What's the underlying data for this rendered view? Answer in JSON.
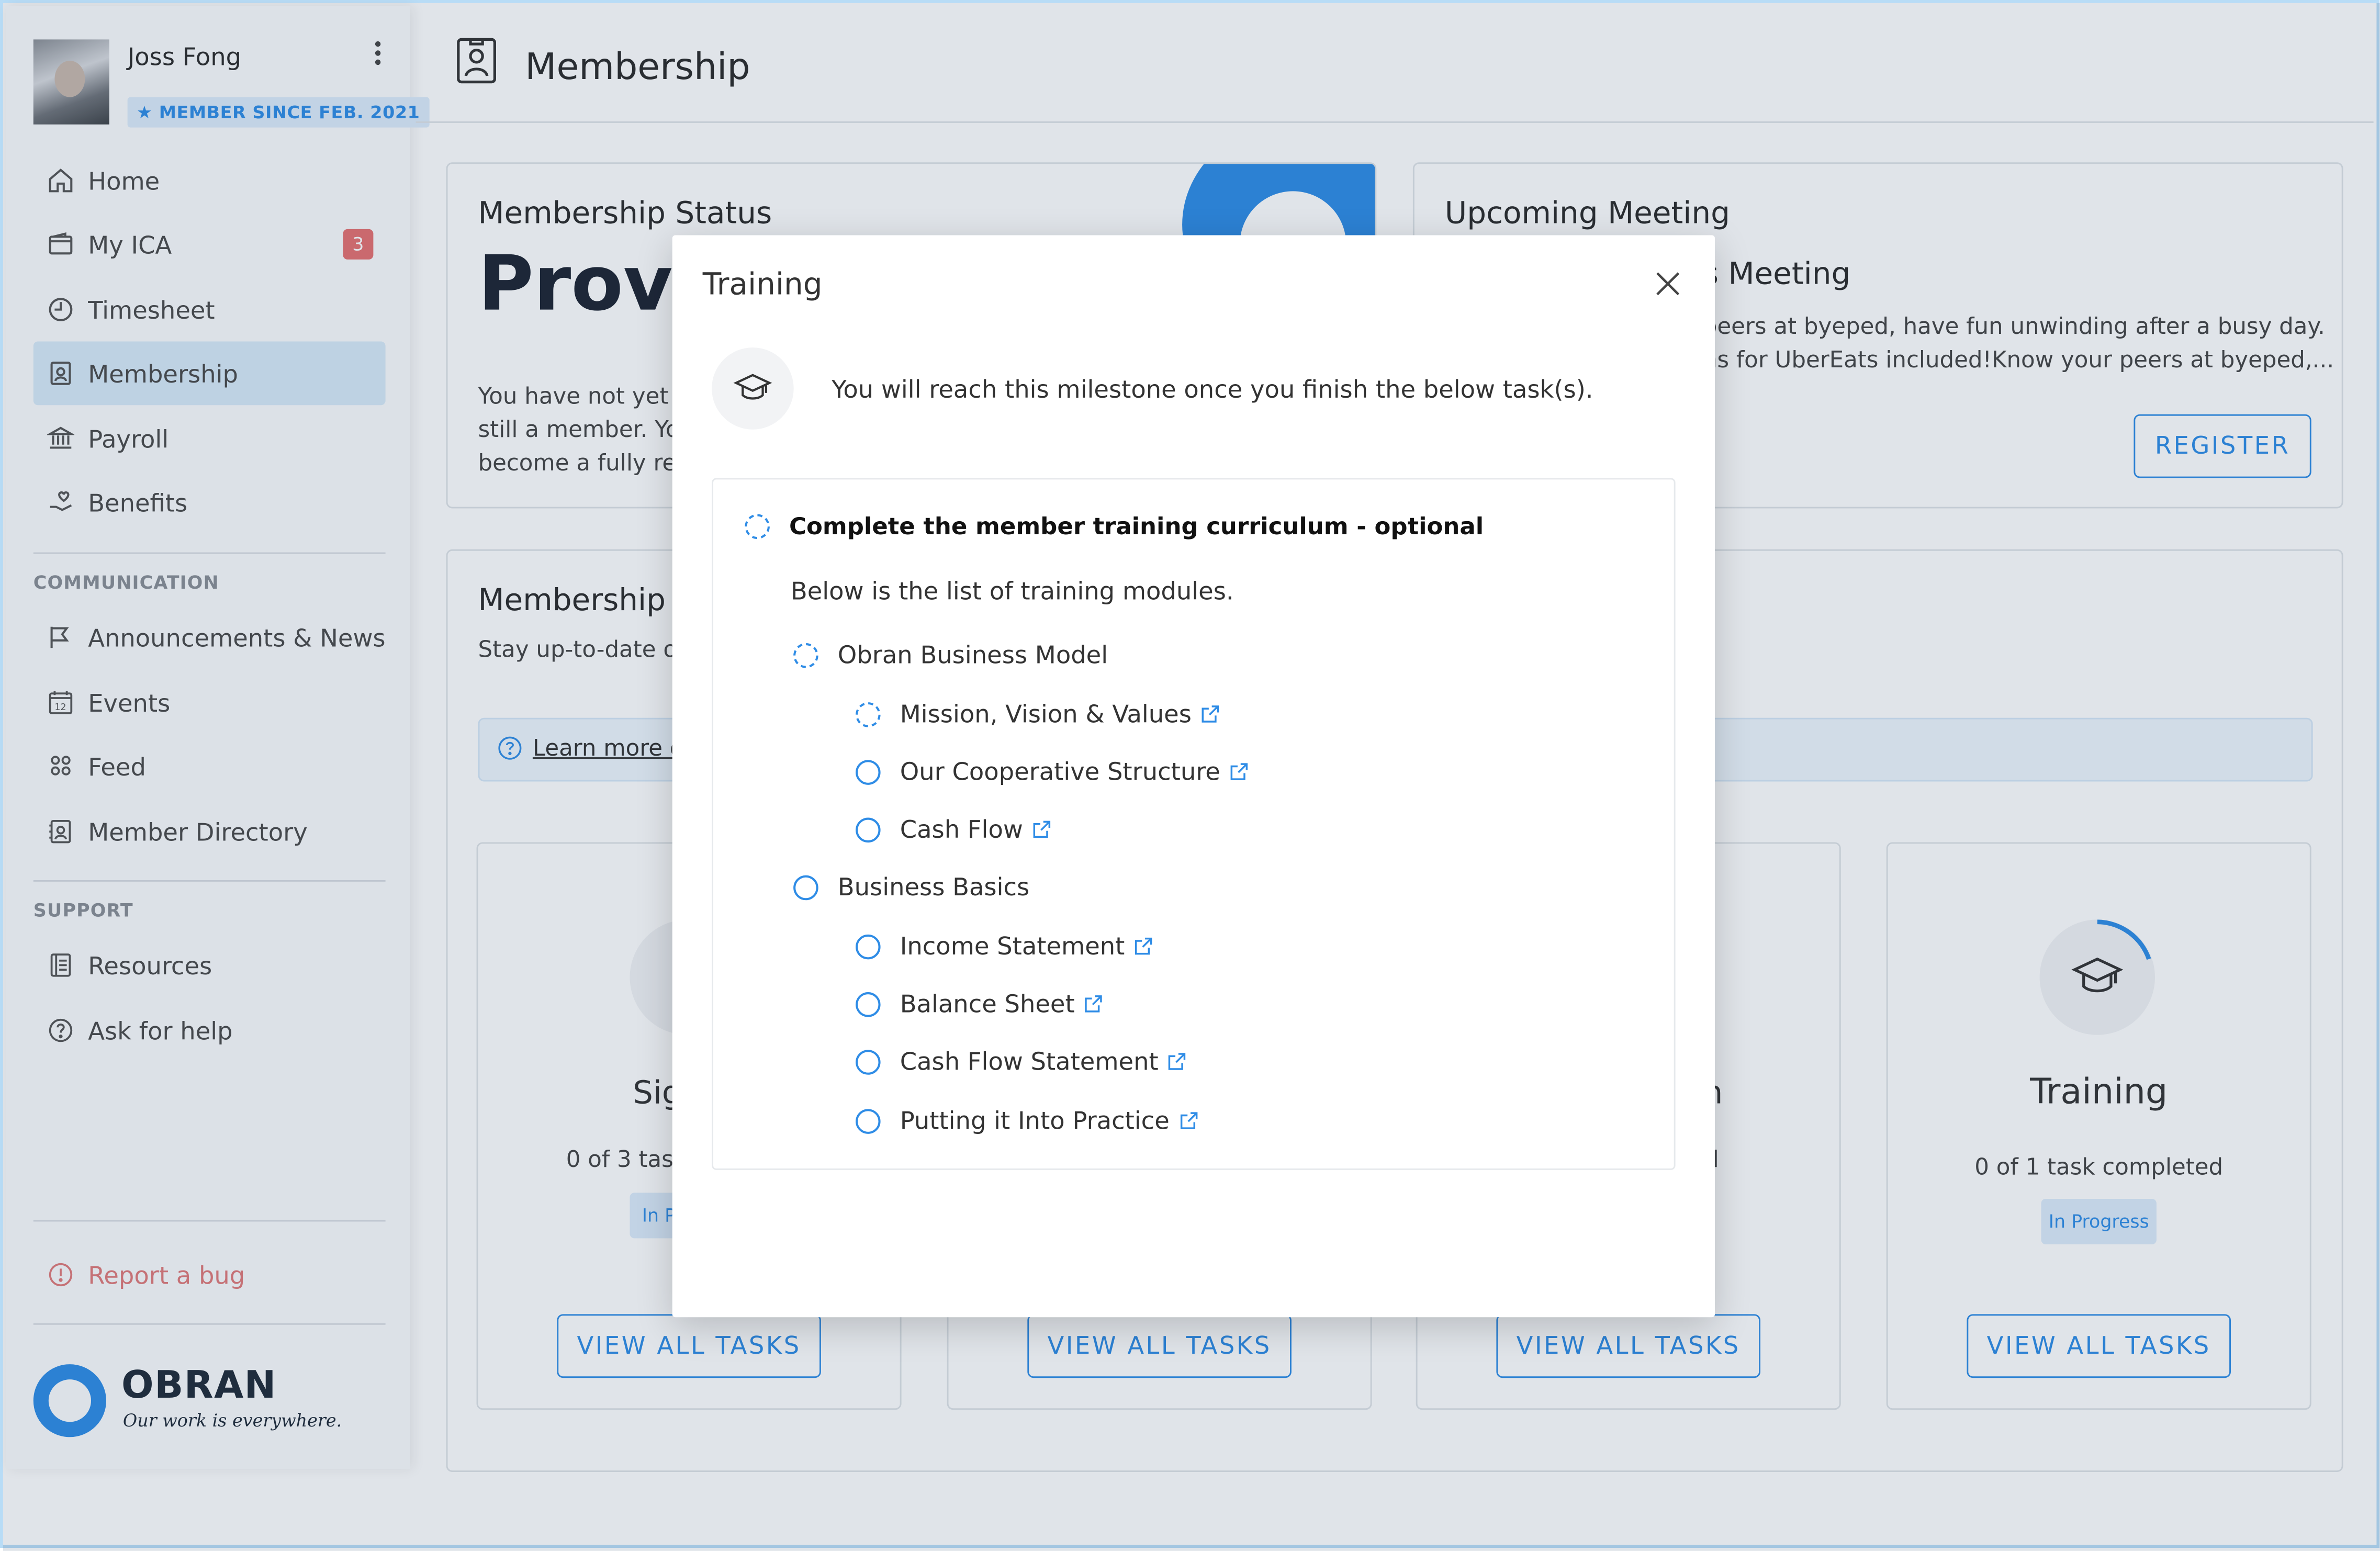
{
  "profile": {
    "name": "Joss Fong",
    "member_since": "MEMBER SINCE FEB. 2021"
  },
  "sidebar": {
    "items": [
      {
        "label": "Home",
        "icon": "home-icon"
      },
      {
        "label": "My ICA",
        "icon": "wallet-icon",
        "badge": "3"
      },
      {
        "label": "Timesheet",
        "icon": "clock-icon"
      },
      {
        "label": "Membership",
        "icon": "badge-icon",
        "active": true
      },
      {
        "label": "Payroll",
        "icon": "bank-icon"
      },
      {
        "label": "Benefits",
        "icon": "hand-heart-icon"
      }
    ],
    "communication_label": "COMMUNICATION",
    "communication": [
      {
        "label": "Announcements & News",
        "icon": "flag-icon"
      },
      {
        "label": "Events",
        "icon": "calendar-icon"
      },
      {
        "label": "Feed",
        "icon": "people-icon"
      },
      {
        "label": "Member Directory",
        "icon": "directory-icon"
      }
    ],
    "support_label": "SUPPORT",
    "support": [
      {
        "label": "Resources",
        "icon": "book-icon"
      },
      {
        "label": "Ask for help",
        "icon": "question-icon"
      }
    ],
    "report_bug": "Report a bug"
  },
  "brand": {
    "name": "OBRAN",
    "tagline": "Our work is everywhere.",
    "accent": "#2e8ce6"
  },
  "header": {
    "title": "Membership"
  },
  "status_card": {
    "title": "Membership Status",
    "status": "Provis",
    "text_lines": [
      "You have not yet m",
      "still a member. You",
      "become a fully rec"
    ]
  },
  "agreement_card": {
    "title": "Membership A",
    "subtitle": "Stay up-to-date or",
    "learn_more": "Learn more d"
  },
  "meeting_card": {
    "title": "Upcoming Meeting",
    "meeting_name": "s Meeting",
    "desc_lines": [
      "peers at byeped, have fun unwinding after a busy day.",
      "ns for UberEats included!Know your peers at byeped,..."
    ],
    "register": "REGISTER"
  },
  "task_cards": [
    {
      "title": "Sig",
      "progress": "0 of 3 task",
      "status": "In P",
      "button": "VIEW ALL TASKS"
    },
    {
      "title": "",
      "progress": "",
      "status": "",
      "button": "VIEW ALL TASKS"
    },
    {
      "title": "n",
      "progress": "ted",
      "status": "",
      "button": "VIEW ALL TASKS"
    },
    {
      "title": "Training",
      "progress": "0 of 1 task completed",
      "status": "In Progress",
      "button": "VIEW ALL TASKS"
    }
  ],
  "modal": {
    "title": "Training",
    "intro": "You will reach this milestone once you finish the below task(s).",
    "task": "Complete the member training curriculum - optional",
    "subtitle": "Below is the list of training modules.",
    "groups": [
      {
        "name": "Obran Business Model",
        "state": "in-progress",
        "modules": [
          {
            "name": "Mission, Vision & Values",
            "state": "in-progress"
          },
          {
            "name": "Our Cooperative Structure",
            "state": "todo"
          },
          {
            "name": "Cash Flow",
            "state": "todo"
          }
        ]
      },
      {
        "name": "Business Basics",
        "state": "todo",
        "modules": [
          {
            "name": "Income Statement",
            "state": "todo"
          },
          {
            "name": "Balance Sheet",
            "state": "todo"
          },
          {
            "name": "Cash Flow Statement",
            "state": "todo"
          },
          {
            "name": "Putting it Into Practice",
            "state": "todo"
          }
        ]
      }
    ]
  }
}
